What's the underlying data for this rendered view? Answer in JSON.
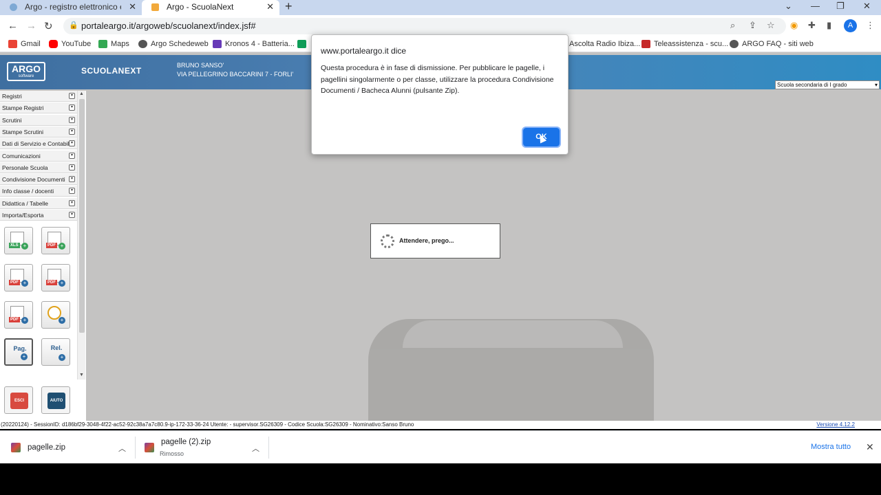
{
  "browser": {
    "tabs": [
      {
        "title": "Argo - registro elettronico e altri",
        "active": false
      },
      {
        "title": "Argo - ScuolaNext",
        "active": true
      }
    ],
    "url": "portaleargo.it/argoweb/scuolanext/index.jsf#",
    "avatar_letter": "A",
    "bookmarks": [
      {
        "label": "Gmail",
        "color": "#ea4335"
      },
      {
        "label": "YouTube",
        "color": "#ff0000"
      },
      {
        "label": "Maps",
        "color": "#34a853"
      },
      {
        "label": "Argo Schedeweb",
        "color": "#555555"
      },
      {
        "label": "Kronos 4 - Batteria...",
        "color": "#673ab7"
      },
      {
        "label": "Ascolta Radio Ibiza...",
        "color": "#ffffff"
      },
      {
        "label": "Teleassistenza - scu...",
        "color": "#c62828"
      },
      {
        "label": "ARGO FAQ - siti web",
        "color": "#555555"
      }
    ]
  },
  "app": {
    "logo": "ARGO",
    "logo_sub": "software",
    "product": "SCUOLANEXT",
    "user_name": "BRUNO SANSO'",
    "school_address": "VIA PELLEGRINO BACCARINI 7 - FORLI'",
    "school_level": "Scuola secondaria di I grado",
    "menu": [
      "Registri",
      "Stampe Registri",
      "Scrutini",
      "Stampe Scrutini",
      "Dati di Servizio e Contabili",
      "Comunicazioni",
      "Personale Scuola",
      "Condivisione Documenti",
      "Info classe / docenti",
      "Didattica / Tabelle",
      "Importa/Esporta"
    ],
    "tiles": [
      {
        "tag": "XLS",
        "tag_color": "#3aa35a"
      },
      {
        "tag": "PDF",
        "tag_color": "#d9403a"
      },
      {
        "tag": "PDF",
        "tag_color": "#d9403a"
      },
      {
        "tag": "PDF",
        "tag_color": "#d9403a"
      },
      {
        "tag": "PDF",
        "tag_color": "#d9403a"
      },
      {
        "tag": "",
        "tag_color": ""
      }
    ],
    "tile_pag": "Pag.",
    "tile_rel": "Rel.",
    "exit_label": "ESCI",
    "help_label": "AIUTO",
    "loading_text": "Attendere, prego...",
    "status_line": "(20220124) - SessionID: d186bf29-3048-4f22-ac52-92c38a7a7c80.9-ip-172-33-36-24 Utente: - supervisor.SG26309 - Codice Scuola:SG26309 - Nominativo:Sanso Bruno",
    "version": "Versione 4.12.2"
  },
  "dialog": {
    "title": "www.portaleargo.it dice",
    "message": "Questa procedura è in fase di dismissione. Per pubblicare le pagelle, i pagellini singolarmente o per classe, utilizzare la procedura Condivisione Documenti / Bacheca Alunni (pulsante Zip).",
    "ok_label": "OK"
  },
  "downloads": {
    "items": [
      {
        "name": "pagelle.zip",
        "status": ""
      },
      {
        "name": "pagelle (2).zip",
        "status": "Rimosso"
      }
    ],
    "show_all": "Mostra tutto"
  }
}
